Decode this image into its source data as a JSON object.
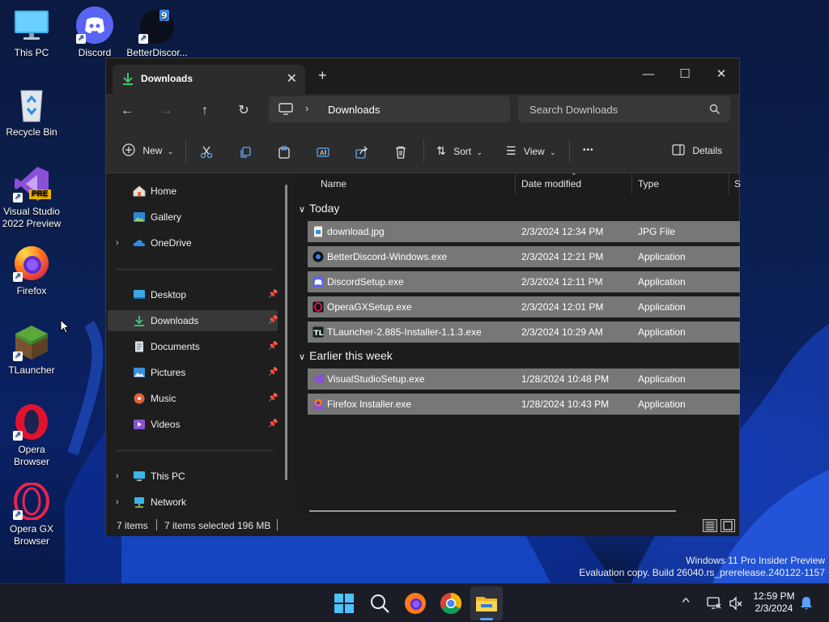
{
  "desktop": {
    "icons": [
      {
        "label": "This PC"
      },
      {
        "label": "Discord"
      },
      {
        "label": "BetterDiscor..."
      },
      {
        "label": "Recycle Bin"
      },
      {
        "label": "Visual Studio 2022 Preview",
        "badge": "PRE"
      },
      {
        "label": "Firefox"
      },
      {
        "label": "TLauncher"
      },
      {
        "label": "Opera Browser"
      },
      {
        "label": "Opera GX Browser"
      }
    ],
    "watermark": {
      "line1": "Windows 11 Pro Insider Preview",
      "line2": "Evaluation copy. Build 26040.rs_prerelease.240122-1157"
    }
  },
  "explorer": {
    "tab": {
      "label": "Downloads",
      "close": "✕"
    },
    "new_tab": "+",
    "window_controls": {
      "minimize": "—",
      "maximize": "☐",
      "close": "✕"
    },
    "nav": {
      "back": "←",
      "forward": "→",
      "up": "↑",
      "refresh": "↻"
    },
    "address": {
      "separator": "›",
      "location": "Downloads"
    },
    "search": {
      "placeholder": "Search Downloads"
    },
    "toolbar": {
      "new_label": "New",
      "sort_label": "Sort",
      "view_label": "View",
      "more": "•••",
      "details_label": "Details"
    },
    "nav_pane": {
      "items": [
        {
          "label": "Home"
        },
        {
          "label": "Gallery"
        },
        {
          "label": "OneDrive"
        },
        {
          "label": "Desktop"
        },
        {
          "label": "Downloads"
        },
        {
          "label": "Documents"
        },
        {
          "label": "Pictures"
        },
        {
          "label": "Music"
        },
        {
          "label": "Videos"
        },
        {
          "label": "This PC"
        },
        {
          "label": "Network"
        }
      ]
    },
    "columns": {
      "name": "Name",
      "date": "Date modified",
      "type": "Type",
      "size": "S"
    },
    "groups": [
      {
        "title": "Today",
        "files": [
          {
            "name": "download.jpg",
            "date": "2/3/2024 12:34 PM",
            "type": "JPG File"
          },
          {
            "name": "BetterDiscord-Windows.exe",
            "date": "2/3/2024 12:21 PM",
            "type": "Application"
          },
          {
            "name": "DiscordSetup.exe",
            "date": "2/3/2024 12:11 PM",
            "type": "Application"
          },
          {
            "name": "OperaGXSetup.exe",
            "date": "2/3/2024 12:01 PM",
            "type": "Application"
          },
          {
            "name": "TLauncher-2.885-Installer-1.1.3.exe",
            "date": "2/3/2024 10:29 AM",
            "type": "Application"
          }
        ]
      },
      {
        "title": "Earlier this week",
        "files": [
          {
            "name": "VisualStudioSetup.exe",
            "date": "1/28/2024 10:48 PM",
            "type": "Application"
          },
          {
            "name": "Firefox Installer.exe",
            "date": "1/28/2024 10:43 PM",
            "type": "Application"
          }
        ]
      }
    ],
    "status": {
      "count": "7 items",
      "selected": "7 items selected",
      "size": "196 MB"
    }
  },
  "taskbar": {
    "clock": {
      "time": "12:59 PM",
      "date": "2/3/2024"
    },
    "tray_chevron": "^"
  }
}
